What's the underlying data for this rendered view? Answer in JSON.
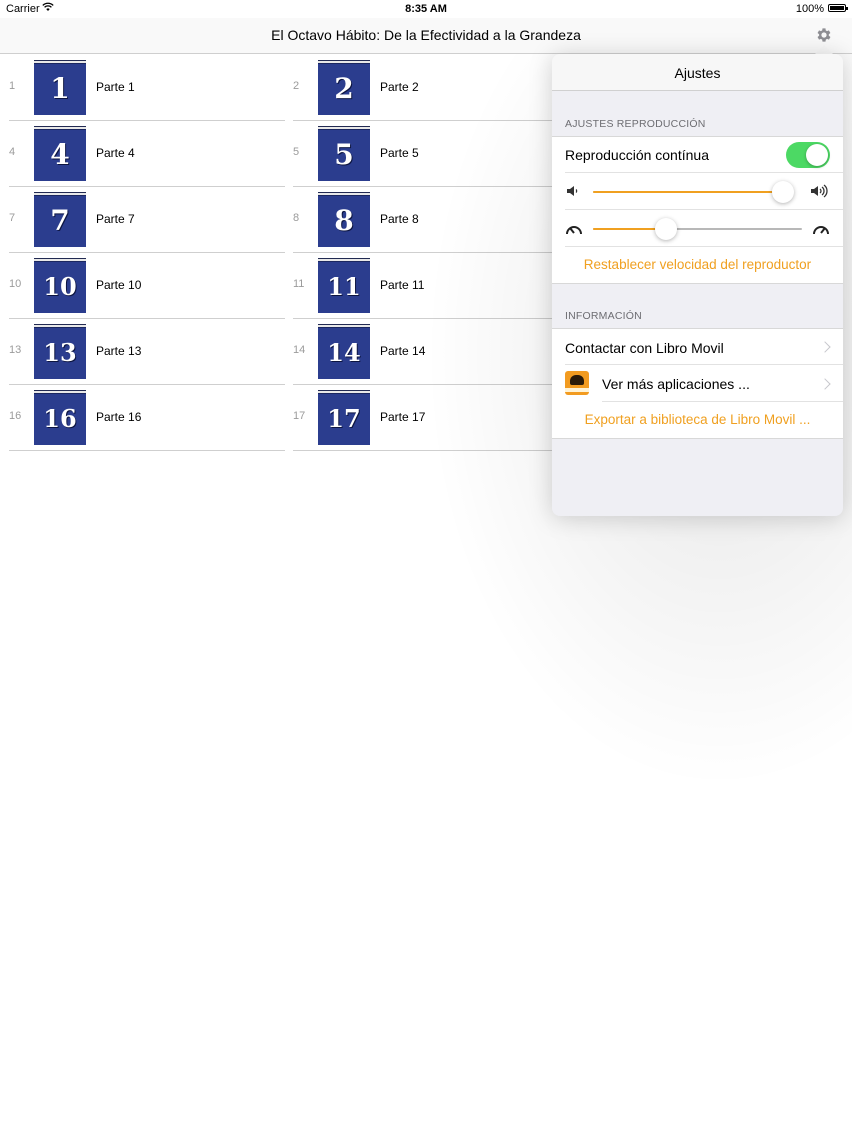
{
  "status_bar": {
    "carrier": "Carrier",
    "time": "8:35 AM",
    "battery_percent": "100%",
    "wifi_icon": "wifi-icon",
    "battery_icon": "battery-icon"
  },
  "nav": {
    "title": "El Octavo Hábito: De la Efectividad a la Grandeza",
    "settings_icon": "gear-icon"
  },
  "parts": [
    {
      "index": "1",
      "digit": "1",
      "label": "Parte 1"
    },
    {
      "index": "2",
      "digit": "2",
      "label": "Parte 2"
    },
    {
      "index": "4",
      "digit": "4",
      "label": "Parte 4"
    },
    {
      "index": "5",
      "digit": "5",
      "label": "Parte 5"
    },
    {
      "index": "7",
      "digit": "7",
      "label": "Parte 7"
    },
    {
      "index": "8",
      "digit": "8",
      "label": "Parte 8"
    },
    {
      "index": "10",
      "digit": "10",
      "label": "Parte 10"
    },
    {
      "index": "11",
      "digit": "11",
      "label": "Parte 11"
    },
    {
      "index": "13",
      "digit": "13",
      "label": "Parte 13"
    },
    {
      "index": "14",
      "digit": "14",
      "label": "Parte 14"
    },
    {
      "index": "16",
      "digit": "16",
      "label": "Parte 16"
    },
    {
      "index": "17",
      "digit": "17",
      "label": "Parte 17"
    }
  ],
  "settings": {
    "title": "Ajustes",
    "playback_section": "AJUSTES REPRODUCCIÓN",
    "continuous_play_label": "Reproducción contínua",
    "continuous_play_on": true,
    "volume_level": 0.95,
    "speed_level": 0.35,
    "reset_speed_label": "Restablecer velocidad del reproductor",
    "info_section": "INFORMACIÓN",
    "contact_label": "Contactar con Libro Movil",
    "more_apps_label": "Ver más aplicaciones ...",
    "export_label": "Exportar a biblioteca de Libro Movil ...",
    "accent_color": "#f0a020",
    "toggle_color": "#4cd964"
  }
}
